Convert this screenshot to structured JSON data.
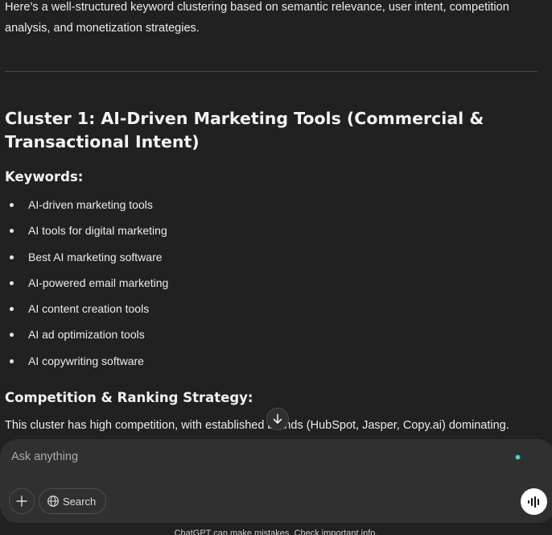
{
  "response": {
    "intro": "Here’s a well-structured keyword clustering based on semantic relevance, user intent, competition analysis, and monetization strategies.",
    "cluster_title": "Cluster 1: AI-Driven Marketing Tools (Commercial & Transactional Intent)",
    "keywords_heading": "Keywords:",
    "keywords": [
      "AI-driven marketing tools",
      "AI tools for digital marketing",
      "Best AI marketing software",
      "AI-powered email marketing",
      "AI content creation tools",
      "AI ad optimization tools",
      "AI copywriting software"
    ],
    "competition_heading": "Competition & Ranking Strategy:",
    "competition_text": "This cluster has high competition, with established brands (HubSpot, Jasper, Copy.ai) dominating."
  },
  "composer": {
    "placeholder": "Ask anything",
    "search_label": "Search"
  },
  "footer": {
    "note": "ChatGPT can make mistakes. Check important info."
  },
  "icons": {
    "scroll": "arrow-down-icon",
    "plus": "plus-icon",
    "search": "globe-icon",
    "voice": "voice-waveform-icon"
  }
}
